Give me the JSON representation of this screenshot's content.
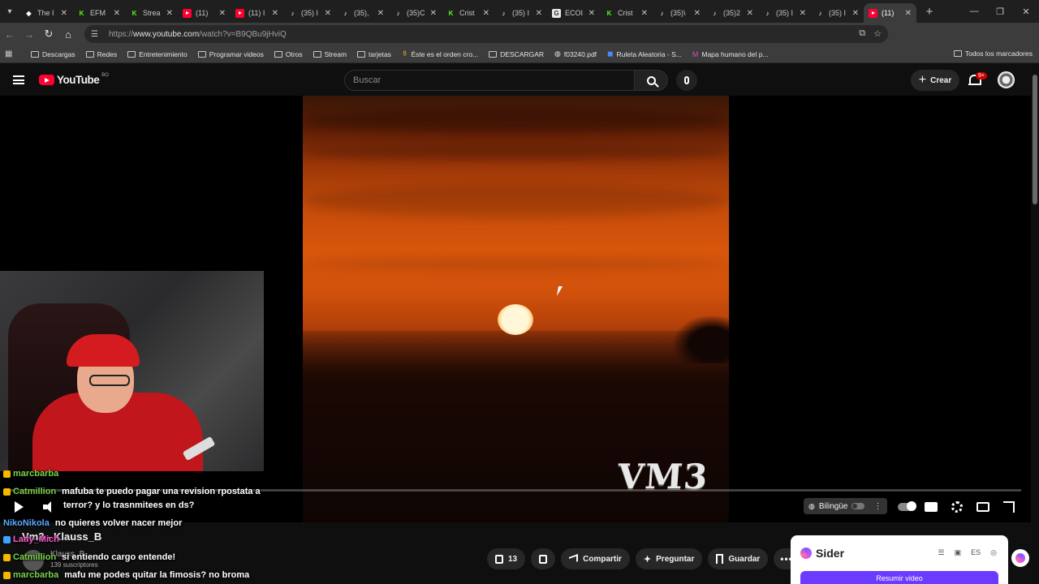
{
  "browser": {
    "tabs": [
      {
        "label": "The I",
        "icon": "the-icon"
      },
      {
        "label": "EFM",
        "icon": "kick-icon"
      },
      {
        "label": "Strea",
        "icon": "kick-icon"
      },
      {
        "label": "(11)",
        "icon": "youtube-icon"
      },
      {
        "label": "(11) I",
        "icon": "youtube-icon"
      },
      {
        "label": "(35) I",
        "icon": "tiktok-icon"
      },
      {
        "label": "(35),",
        "icon": "tiktok-icon"
      },
      {
        "label": "(35)C",
        "icon": "tiktok-icon"
      },
      {
        "label": "Crist",
        "icon": "kick-icon"
      },
      {
        "label": "(35) I",
        "icon": "tiktok-icon"
      },
      {
        "label": "ECOI",
        "icon": "globe-icon"
      },
      {
        "label": "Crist",
        "icon": "kick-icon"
      },
      {
        "label": "(35)\\",
        "icon": "tiktok-icon"
      },
      {
        "label": "(35)2",
        "icon": "tiktok-icon"
      },
      {
        "label": "(35) I",
        "icon": "tiktok-icon"
      },
      {
        "label": "(35) I",
        "icon": "tiktok-icon"
      },
      {
        "label": "(11)",
        "icon": "youtube-icon",
        "active": true
      }
    ],
    "url_prefix": "https://",
    "url_host": "www.youtube.com",
    "url_path": "/watch?v=B9QBu9jHviQ",
    "bookmarks": [
      {
        "label": "Descargas",
        "icon": "folder-icon"
      },
      {
        "label": "Redes",
        "icon": "folder-icon"
      },
      {
        "label": "Entretenimiento",
        "icon": "folder-icon"
      },
      {
        "label": "Programar videos",
        "icon": "folder-icon"
      },
      {
        "label": "Otros",
        "icon": "folder-icon"
      },
      {
        "label": "Stream",
        "icon": "folder-icon"
      },
      {
        "label": "tarjetas",
        "icon": "folder-icon"
      },
      {
        "label": "Éste es el orden cro...",
        "icon": "bottle-icon"
      },
      {
        "label": "DESCARGAR",
        "icon": "folder-icon"
      },
      {
        "label": "f03240.pdf",
        "icon": "globe-icon"
      },
      {
        "label": "Ruleta Aleatoria - S...",
        "icon": "wheel-icon"
      },
      {
        "label": "Mapa humano del p...",
        "icon": "map-icon"
      }
    ],
    "all_bookmarks": "Todos los marcadores"
  },
  "youtube": {
    "logo_text": "YouTube",
    "country": "BO",
    "search_placeholder": "Buscar",
    "create_label": "Crear",
    "notif_count": "9+",
    "player": {
      "overlay_text": "VM3",
      "bilingual_label": "Bilingüe",
      "progress_fraction": 0.0
    },
    "ghost_title": "Vm3 - Klauss_B",
    "ghost_channel": "Klauss_B",
    "ghost_subs": "139 suscriptores",
    "like_count": "13",
    "share_label": "Compartir",
    "ask_label": "Preguntar",
    "save_label": "Guardar"
  },
  "chat": [
    {
      "user": "marcbarba",
      "text": "",
      "color": "#7bd34a",
      "top": 0
    },
    {
      "user": "Catmillion",
      "text": "mafuba te puedo pagar una revision rpostata a",
      "color": "#7bd34a"
    },
    {
      "user": "",
      "text": "terror? y lo trasnmitees en ds?",
      "color": "#fff"
    },
    {
      "user": "NikoNikola",
      "text": "no quieres volver nacer mejor",
      "color": "#5aa9ff"
    },
    {
      "user": "Lady_Mich",
      "text": "",
      "color": "#ff5ad1"
    },
    {
      "user": "Catmillion",
      "text": "si entiendo cargo entende!",
      "color": "#7bd34a"
    },
    {
      "user": "marcbarba",
      "text": "mafu me podes quitar la fimosis? no broma",
      "color": "#7bd34a"
    }
  ],
  "sider": {
    "name": "Sider",
    "lang": "ES",
    "summarize_label": "Resumir video"
  }
}
